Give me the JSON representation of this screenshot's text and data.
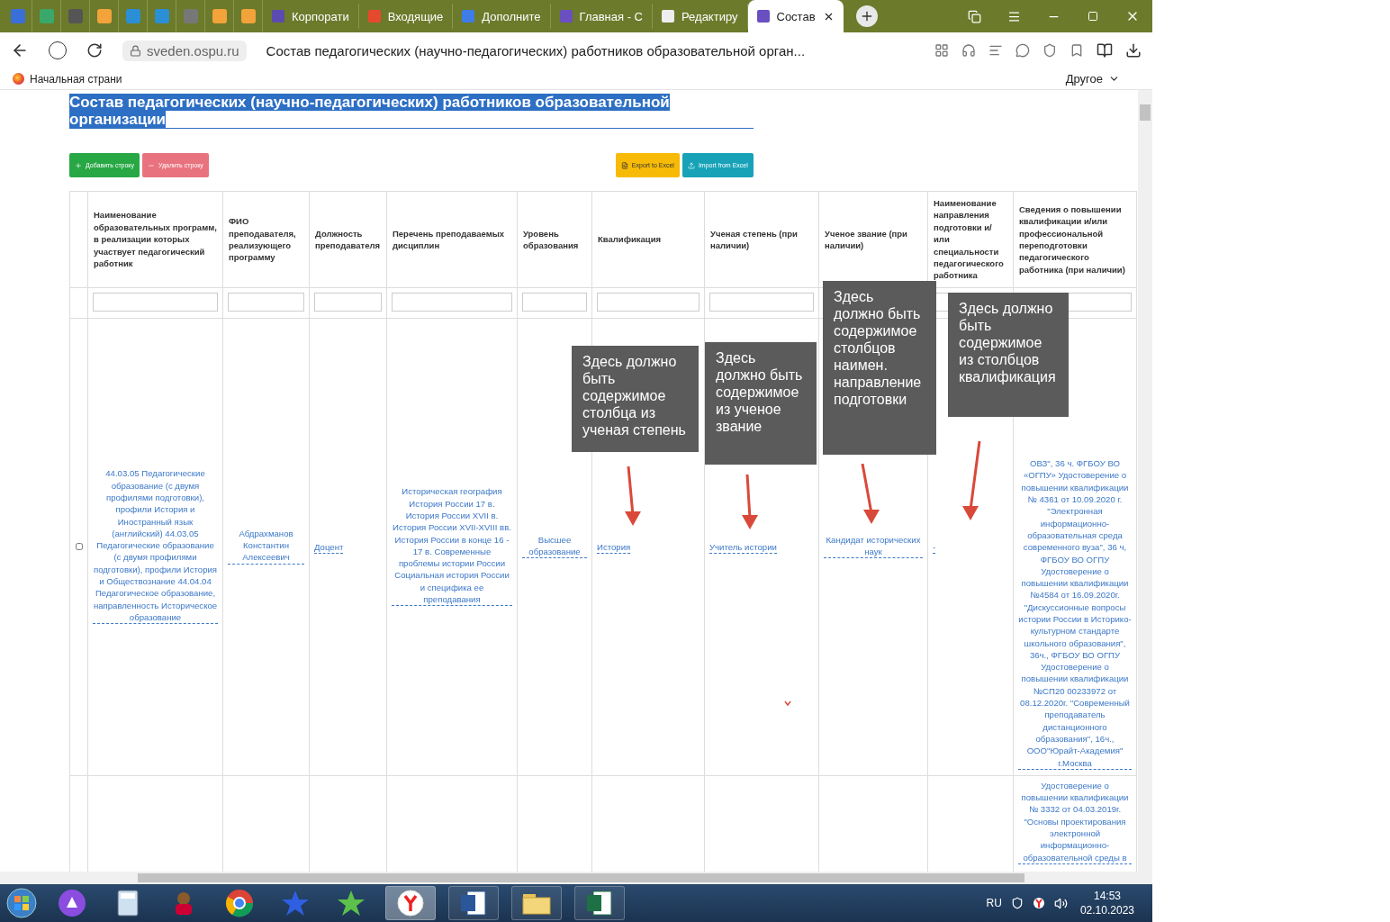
{
  "browser": {
    "tabs": [
      {
        "label": "Корпорати",
        "selected": false
      },
      {
        "label": "Входящие",
        "selected": false
      },
      {
        "label": "Дополните",
        "selected": false
      },
      {
        "label": "Главная - С",
        "selected": false
      },
      {
        "label": "Редактиру",
        "selected": false
      },
      {
        "label": "Состав",
        "selected": true
      }
    ],
    "address": {
      "domain": "sveden.ospu.ru",
      "title": "Состав педагогических (научно-педагогических) работников образовательной орган..."
    },
    "bookmarks": [
      {
        "label": "Начальная страни"
      }
    ],
    "other_bookmarks": "Другое"
  },
  "page": {
    "title": "Состав педагогических (научно-педагогических) работников образовательной организации",
    "actions": [
      {
        "kind": "add",
        "label": "Добавить строку"
      },
      {
        "kind": "remove",
        "label": "Удалить строку"
      },
      {
        "kind": "export",
        "label": "Export to Excel"
      },
      {
        "kind": "import",
        "label": "Import from Excel"
      }
    ],
    "table": {
      "columns": [
        "Наименование образовательных программ, в реализации которых участвует педагогический работник",
        "ФИО преподавателя, реализующего программу",
        "Должность преподавателя",
        "Перечень преподаваемых дисциплин",
        "Уровень образования",
        "Квалификация",
        "Ученая степень (при наличии)",
        "Ученое звание (при наличии)",
        "Наименование направления подготовки и/или специальности педагогического работника",
        "Сведения о повышении квалификации и/или профессиональной переподготовки педагогического работника (при наличии)"
      ],
      "rows": [
        {
          "checked": false,
          "cells": [
            "44.03.05 Педагогические образование (с двумя профилями подготовки), профили История и Иностранный язык (английский) 44.03.05 Педагогические образование (с двумя профилями подготовки), профили История и Обществознание 44.04.04 Педагогическое образование, направленность Историческое образование",
            "Абдрахманов Константин Алексеевич",
            "Доцент",
            "Историческая география История России 17 в. История России XVII в. История России XVII-XVIII вв. История России в конце 16 - 17 в. Современные проблемы истории России Социальная история России и специфика ее преподавания",
            "Высшее образование",
            "История",
            "Учитель истории",
            "Кандидат исторических наук",
            "-",
            "ОВЗ\", 36 ч. ФГБОУ ВО «ОГПУ» Удостоверение о повышении квалификации № 4361 от 10.09.2020 г. \"Электронная информационно-образовательная среда современного вуза\", 36 ч, ФГБОУ ВО ОГПУ Удостоверение о повышении квалификации №4584 от 16.09.2020г. \"Дискуссионные вопросы истории России в Историко-культурном стандарте школьного образования\", 36ч., ФГБОУ ВО ОГПУ Удостоверение о повышении квалификации №СП20 00233972 от 08.12.2020г. \"Современный преподаватель дистанционного образования\", 16ч., ООО\"Юрайт-Академия\" г.Москва"
          ]
        },
        {
          "cells": [
            null,
            null,
            null,
            null,
            null,
            null,
            null,
            null,
            null,
            "Удостоверение о повышении квалификации № 3332 от 04.03.2019г. \"Основы проектирования электронной информационно-образовательной среды в"
          ]
        }
      ]
    },
    "notes": [
      {
        "text": "Здесь должно быть содержимое столбца из ученая степень"
      },
      {
        "text": "Здесь должно быть содержимое из ученое звание"
      },
      {
        "text": "Здесь должно быть содержимое столбцов наимен. направление подготовки"
      },
      {
        "text": "Здесь должно быть содержимое из столбцов квалификация"
      }
    ]
  },
  "taskbar": {
    "language": "RU",
    "time": "14:53",
    "date": "02.10.2023"
  }
}
